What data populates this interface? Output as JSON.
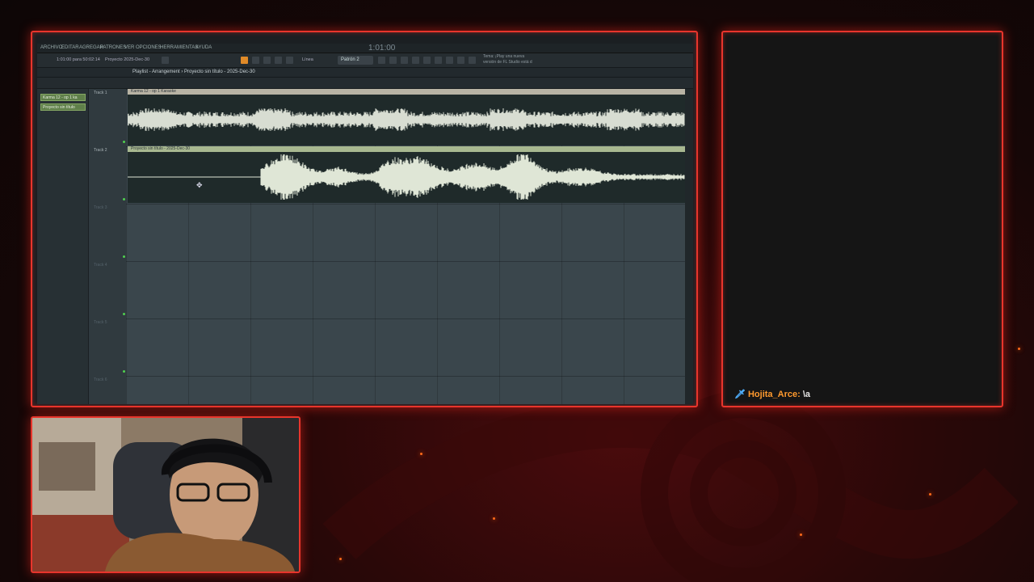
{
  "daw": {
    "menu_items": [
      "ARCHIVO",
      "EDITAR",
      "AGREGAR",
      "PATRONES",
      "VER",
      "OPCIONES",
      "HERRAMIENTAS",
      "AYUDA"
    ],
    "time_status": "1:01:00 para 50:02:14",
    "project_status": "Proyecto 2025-Dec-30",
    "tempo": "1:01:00",
    "pattern": "Patrón 2",
    "snap": "Línea",
    "hint_line1": "Tema: ¡Play una nueva",
    "hint_line2": "versión de FL Studio está d",
    "playlist_title": "Playlist - Arrangement › Proyecto sin título - 2025-Dec-30",
    "picker_clips": [
      "Karma 12 - op 1 ka",
      "Proyecto sin título"
    ],
    "tracks": [
      "Track 1",
      "Track 2",
      "Track 3",
      "Track 4",
      "Track 5",
      "Track 6"
    ],
    "clips": [
      {
        "label": "Karma 12 - op 1 Karaoke",
        "header_color": "#b8b3a4",
        "wave_color": "#d8ddd2"
      },
      {
        "label": "Proyecto sin título - 2025-Dec-30",
        "header_color": "#a8b890",
        "wave_color": "#dfe6d6"
      }
    ]
  },
  "chat": {
    "icon": "sword-icon",
    "username": "Hojita_Arce:",
    "message": "\\a"
  },
  "colors": {
    "frame_border": "#e8352c",
    "chat_username": "#ff9a2e"
  }
}
